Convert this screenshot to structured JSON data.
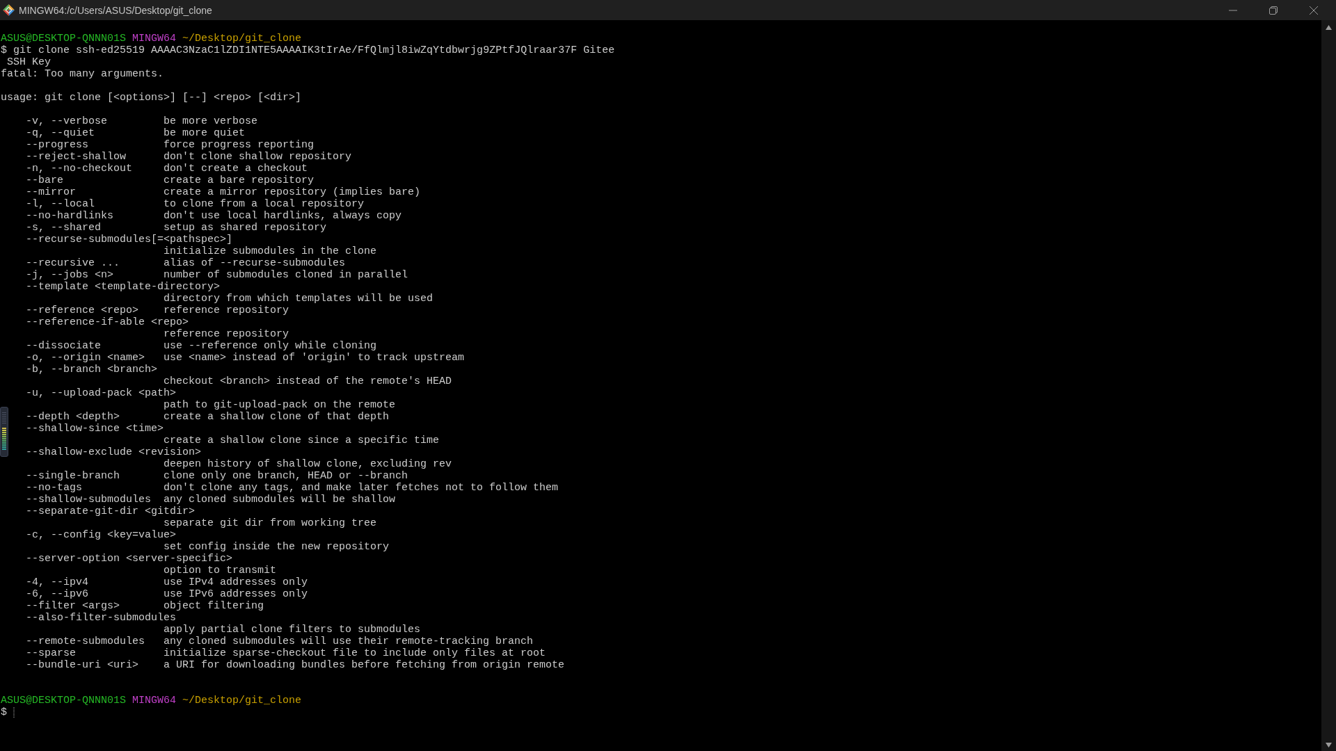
{
  "window": {
    "title": "MINGW64:/c/Users/ASUS/Desktop/git_clone"
  },
  "terminal": {
    "prompt": {
      "user_host": "ASUS@DESKTOP-QNNN01S",
      "shell": "MINGW64",
      "path": "~/Desktop/git_clone"
    },
    "command": {
      "symbol": "$",
      "text": "git clone ssh-ed25519 AAAAC3NzaC1lZDI1NTE5AAAAIK3tIrAe/FfQlmjl8iwZqYtdbwrjg9ZPtfJQlraar37F Gitee",
      "continuation": "SSH Key"
    },
    "error": "fatal: Too many arguments.",
    "usage": "usage: git clone [<options>] [--] <repo> [<dir>]",
    "options": [
      {
        "kind": "inline",
        "flag": "-v, --verbose",
        "description": "be more verbose"
      },
      {
        "kind": "inline",
        "flag": "-q, --quiet",
        "description": "be more quiet"
      },
      {
        "kind": "inline",
        "flag": "--progress",
        "description": "force progress reporting"
      },
      {
        "kind": "inline",
        "flag": "--reject-shallow",
        "description": "don't clone shallow repository"
      },
      {
        "kind": "inline",
        "flag": "-n, --no-checkout",
        "description": "don't create a checkout"
      },
      {
        "kind": "inline",
        "flag": "--bare",
        "description": "create a bare repository"
      },
      {
        "kind": "inline",
        "flag": "--mirror",
        "description": "create a mirror repository (implies bare)"
      },
      {
        "kind": "inline",
        "flag": "-l, --local",
        "description": "to clone from a local repository"
      },
      {
        "kind": "inline",
        "flag": "--no-hardlinks",
        "description": "don't use local hardlinks, always copy"
      },
      {
        "kind": "inline",
        "flag": "-s, --shared",
        "description": "setup as shared repository"
      },
      {
        "kind": "wrapped",
        "flag": "--recurse-submodules[=<pathspec>]",
        "description": "initialize submodules in the clone"
      },
      {
        "kind": "inline",
        "flag": "--recursive ...",
        "description": "alias of --recurse-submodules"
      },
      {
        "kind": "inline",
        "flag": "-j, --jobs <n>",
        "description": "number of submodules cloned in parallel"
      },
      {
        "kind": "wrapped",
        "flag": "--template <template-directory>",
        "description": "directory from which templates will be used"
      },
      {
        "kind": "inline",
        "flag": "--reference <repo>",
        "description": "reference repository"
      },
      {
        "kind": "wrapped",
        "flag": "--reference-if-able <repo>",
        "description": "reference repository"
      },
      {
        "kind": "inline",
        "flag": "--dissociate",
        "description": "use --reference only while cloning"
      },
      {
        "kind": "inline",
        "flag": "-o, --origin <name>",
        "description": "use <name> instead of 'origin' to track upstream"
      },
      {
        "kind": "wrapped",
        "flag": "-b, --branch <branch>",
        "description": "checkout <branch> instead of the remote's HEAD"
      },
      {
        "kind": "wrapped",
        "flag": "-u, --upload-pack <path>",
        "description": "path to git-upload-pack on the remote"
      },
      {
        "kind": "inline",
        "flag": "--depth <depth>",
        "description": "create a shallow clone of that depth"
      },
      {
        "kind": "wrapped",
        "flag": "--shallow-since <time>",
        "description": "create a shallow clone since a specific time"
      },
      {
        "kind": "wrapped",
        "flag": "--shallow-exclude <revision>",
        "description": "deepen history of shallow clone, excluding rev"
      },
      {
        "kind": "inline",
        "flag": "--single-branch",
        "description": "clone only one branch, HEAD or --branch"
      },
      {
        "kind": "inline",
        "flag": "--no-tags",
        "description": "don't clone any tags, and make later fetches not to follow them"
      },
      {
        "kind": "inline",
        "flag": "--shallow-submodules",
        "description": "any cloned submodules will be shallow"
      },
      {
        "kind": "wrapped",
        "flag": "--separate-git-dir <gitdir>",
        "description": "separate git dir from working tree"
      },
      {
        "kind": "wrapped",
        "flag": "-c, --config <key=value>",
        "description": "set config inside the new repository"
      },
      {
        "kind": "wrapped",
        "flag": "--server-option <server-specific>",
        "description": "option to transmit"
      },
      {
        "kind": "inline",
        "flag": "-4, --ipv4",
        "description": "use IPv4 addresses only"
      },
      {
        "kind": "inline",
        "flag": "-6, --ipv6",
        "description": "use IPv6 addresses only"
      },
      {
        "kind": "inline",
        "flag": "--filter <args>",
        "description": "object filtering"
      },
      {
        "kind": "wrapped",
        "flag": "--also-filter-submodules",
        "description": "apply partial clone filters to submodules"
      },
      {
        "kind": "inline",
        "flag": "--remote-submodules",
        "description": "any cloned submodules will use their remote-tracking branch"
      },
      {
        "kind": "inline",
        "flag": "--sparse",
        "description": "initialize sparse-checkout file to include only files at root"
      },
      {
        "kind": "inline",
        "flag": "--bundle-uri <uri>",
        "description": "a URI for downloading bundles before fetching from origin remote"
      }
    ],
    "next_prompt": {
      "user_host": "ASUS@DESKTOP-QNNN01S",
      "shell": "MINGW64",
      "path": "~/Desktop/git_clone"
    },
    "input": {
      "symbol": "$"
    }
  }
}
